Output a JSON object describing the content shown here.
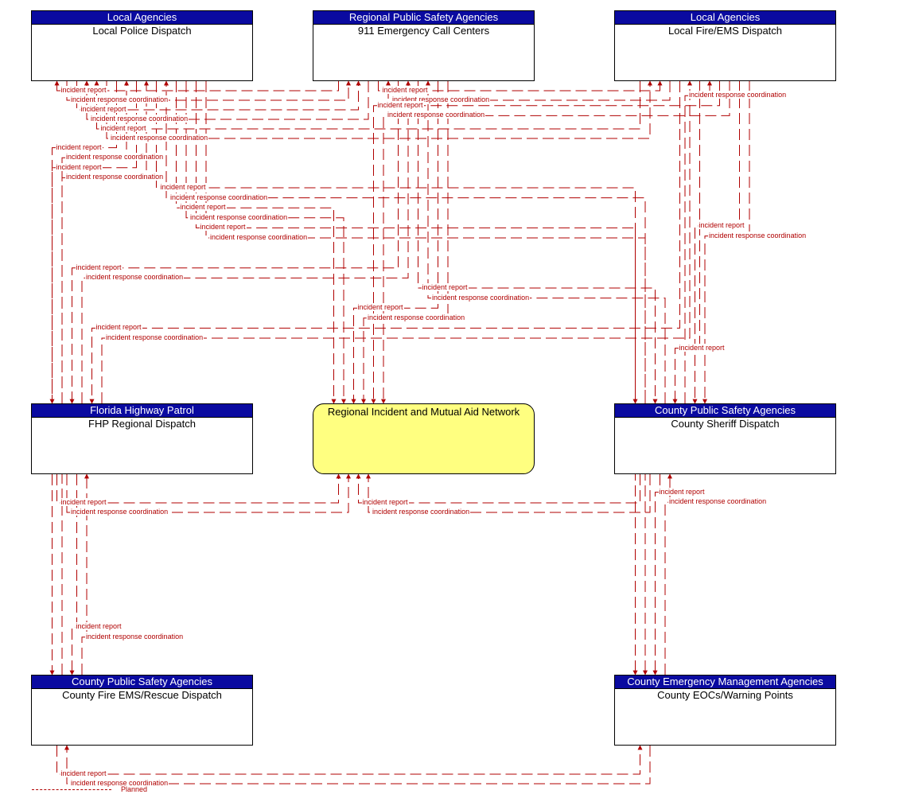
{
  "nodes": {
    "lpd": {
      "category": "Local Agencies",
      "name": "Local Police Dispatch"
    },
    "ecc": {
      "category": "Regional Public Safety Agencies",
      "name": "911 Emergency Call Centers"
    },
    "lfd": {
      "category": "Local Agencies",
      "name": "Local Fire/EMS Dispatch"
    },
    "fhp": {
      "category": "Florida Highway Patrol",
      "name": "FHP Regional Dispatch"
    },
    "rin": {
      "category": "",
      "name": "Regional Incident and Mutual Aid Network"
    },
    "csd": {
      "category": "County Public Safety Agencies",
      "name": "County Sheriff Dispatch"
    },
    "cfd": {
      "category": "County Public Safety Agencies",
      "name": "County Fire EMS/Rescue Dispatch"
    },
    "eoc": {
      "category": "County Emergency Management Agencies",
      "name": "County EOCs/Warning Points"
    }
  },
  "flow_types": {
    "report": "incident report",
    "coord": "incident response coordination"
  },
  "flows": [
    {
      "from": "ecc",
      "to": "lpd",
      "label": "incident report",
      "status": "Planned"
    },
    {
      "from": "lpd",
      "to": "ecc",
      "label": "incident response coordination",
      "status": "Planned"
    },
    {
      "from": "lpd",
      "to": "ecc",
      "label": "incident report",
      "status": "Planned"
    },
    {
      "from": "ecc",
      "to": "lpd",
      "label": "incident response coordination",
      "status": "Planned"
    },
    {
      "from": "lfd",
      "to": "lpd",
      "label": "incident report",
      "status": "Planned"
    },
    {
      "from": "lpd",
      "to": "lfd",
      "label": "incident response coordination",
      "status": "Planned"
    },
    {
      "from": "lpd",
      "to": "fhp",
      "label": "incident report",
      "status": "Planned"
    },
    {
      "from": "fhp",
      "to": "lpd",
      "label": "incident response coordination",
      "status": "Planned"
    },
    {
      "from": "lpd",
      "to": "cfd",
      "label": "incident report",
      "status": "Planned"
    },
    {
      "from": "cfd",
      "to": "lpd",
      "label": "incident response coordination",
      "status": "Planned"
    },
    {
      "from": "lpd",
      "to": "csd",
      "label": "incident report",
      "status": "Planned"
    },
    {
      "from": "csd",
      "to": "lpd",
      "label": "incident response coordination",
      "status": "Planned"
    },
    {
      "from": "lpd",
      "to": "rin",
      "label": "incident report",
      "status": "Planned"
    },
    {
      "from": "lpd",
      "to": "rin",
      "label": "incident response coordination",
      "status": "Planned"
    },
    {
      "from": "lpd",
      "to": "eoc",
      "label": "incident report",
      "status": "Planned"
    },
    {
      "from": "lpd",
      "to": "eoc",
      "label": "incident response coordination",
      "status": "Planned"
    },
    {
      "from": "ecc",
      "to": "lfd",
      "label": "incident report",
      "status": "Planned"
    },
    {
      "from": "lfd",
      "to": "ecc",
      "label": "incident response coordination",
      "status": "Planned"
    },
    {
      "from": "ecc",
      "to": "fhp",
      "label": "incident report",
      "status": "Planned"
    },
    {
      "from": "fhp",
      "to": "ecc",
      "label": "incident response coordination",
      "status": "Planned"
    },
    {
      "from": "ecc",
      "to": "csd",
      "label": "incident report",
      "status": "Planned"
    },
    {
      "from": "csd",
      "to": "ecc",
      "label": "incident response coordination",
      "status": "Planned"
    },
    {
      "from": "ecc",
      "to": "rin",
      "label": "incident report",
      "status": "Planned"
    },
    {
      "from": "ecc",
      "to": "rin",
      "label": "incident response coordination",
      "status": "Planned"
    },
    {
      "from": "lfd",
      "to": "fhp",
      "label": "incident report",
      "status": "Planned"
    },
    {
      "from": "fhp",
      "to": "lfd",
      "label": "incident response coordination",
      "status": "Planned"
    },
    {
      "from": "lfd",
      "to": "csd",
      "label": "incident report",
      "status": "Planned"
    },
    {
      "from": "csd",
      "to": "lfd",
      "label": "incident response coordination",
      "status": "Planned"
    },
    {
      "from": "lfd",
      "to": "rin",
      "label": "incident report",
      "status": "Planned"
    },
    {
      "from": "lfd",
      "to": "rin",
      "label": "incident response coordination",
      "status": "Planned"
    },
    {
      "from": "fhp",
      "to": "rin",
      "label": "incident report",
      "status": "Planned"
    },
    {
      "from": "fhp",
      "to": "rin",
      "label": "incident response coordination",
      "status": "Planned"
    },
    {
      "from": "fhp",
      "to": "cfd",
      "label": "incident report",
      "status": "Planned"
    },
    {
      "from": "cfd",
      "to": "fhp",
      "label": "incident response coordination",
      "status": "Planned"
    },
    {
      "from": "csd",
      "to": "rin",
      "label": "incident report",
      "status": "Planned"
    },
    {
      "from": "csd",
      "to": "rin",
      "label": "incident response coordination",
      "status": "Planned"
    },
    {
      "from": "csd",
      "to": "eoc",
      "label": "incident report",
      "status": "Planned"
    },
    {
      "from": "eoc",
      "to": "csd",
      "label": "incident response coordination",
      "status": "Planned"
    },
    {
      "from": "cfd",
      "to": "eoc",
      "label": "incident report",
      "status": "Planned"
    },
    {
      "from": "eoc",
      "to": "cfd",
      "label": "incident response coordination",
      "status": "Planned"
    },
    {
      "from": "lfd",
      "to": "csd",
      "label": "incident report",
      "status": "Planned"
    },
    {
      "from": "lfd",
      "to": "csd",
      "label": "incident response coordination",
      "status": "Planned"
    }
  ],
  "legend": {
    "status": "Planned"
  }
}
